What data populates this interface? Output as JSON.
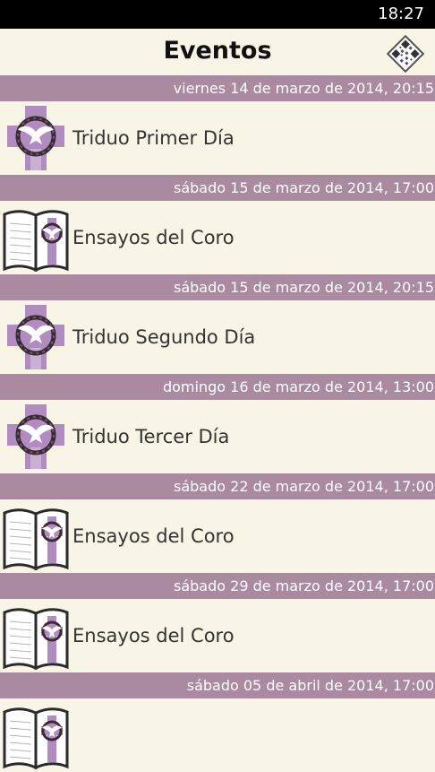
{
  "status": {
    "time": "18:27"
  },
  "header": {
    "title": "Eventos",
    "qr_icon": "qr-code-icon"
  },
  "colors": {
    "background": "#f8f5e6",
    "date_bar": "#a98aa1",
    "accent": "#a07cb0"
  },
  "events": [
    {
      "date": "viernes 14 de marzo de 2014, 20:15",
      "title": "Triduo Primer Día",
      "icon": "cross-dove-icon"
    },
    {
      "date": "sábado 15 de marzo de 2014, 17:00",
      "title": "Ensayos del Coro",
      "icon": "songbook-icon"
    },
    {
      "date": "sábado 15 de marzo de 2014, 20:15",
      "title": "Triduo Segundo Día",
      "icon": "cross-dove-icon"
    },
    {
      "date": "domingo 16 de marzo de 2014, 13:00",
      "title": "Triduo Tercer Día",
      "icon": "cross-dove-icon"
    },
    {
      "date": "sábado 22 de marzo de 2014, 17:00",
      "title": "Ensayos del Coro",
      "icon": "songbook-icon"
    },
    {
      "date": "sábado 29 de marzo de 2014, 17:00",
      "title": "Ensayos del Coro",
      "icon": "songbook-icon"
    },
    {
      "date": "sábado 05 de abril de 2014, 17:00",
      "title": "",
      "icon": "songbook-icon"
    }
  ]
}
